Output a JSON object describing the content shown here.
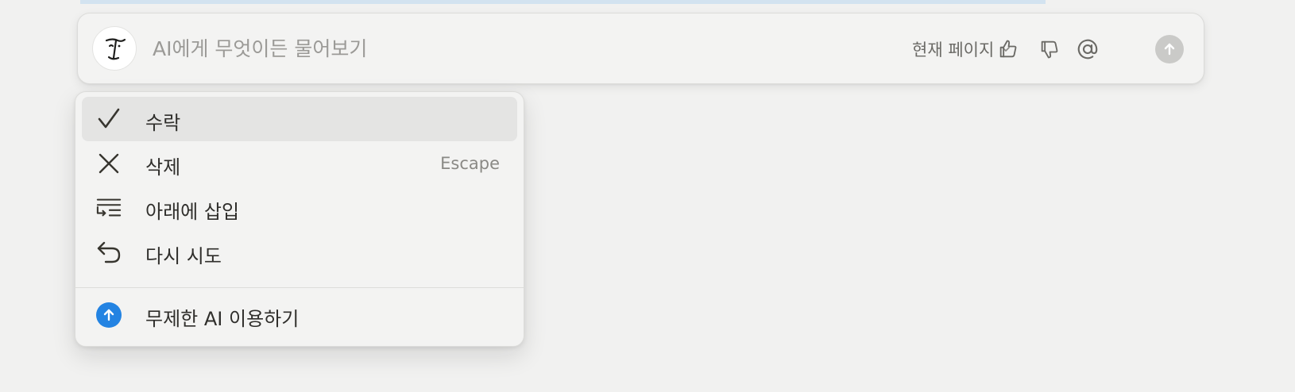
{
  "ai_bar": {
    "avatar_icon": "notion-ai-face-icon",
    "input_placeholder": "AI에게 무엇이든 물어보기",
    "input_value": "",
    "context_label": "현재 페이지",
    "context_icon": "chevron-down-icon",
    "tools": [
      {
        "name": "thumbs-up-icon"
      },
      {
        "name": "thumbs-down-icon"
      },
      {
        "name": "mention-icon"
      }
    ],
    "send_icon": "arrow-up-icon",
    "send_color": "#cacac8"
  },
  "menu": {
    "items": [
      {
        "label": "수락",
        "icon": "checkmark-icon",
        "shortcut": ""
      },
      {
        "label": "삭제",
        "icon": "close-icon",
        "shortcut": "Escape"
      },
      {
        "label": "아래에 삽입",
        "icon": "insert-below-icon",
        "shortcut": ""
      },
      {
        "label": "다시 시도",
        "icon": "retry-icon",
        "shortcut": ""
      }
    ],
    "upgrade": {
      "label": "무제한 AI 이용하기",
      "icon": "upgrade-arrow-icon",
      "color": "#2383e2"
    }
  },
  "colors": {
    "background": "#f1f1f0",
    "accent": "#2383e2",
    "selection": "#d3e3f0"
  }
}
